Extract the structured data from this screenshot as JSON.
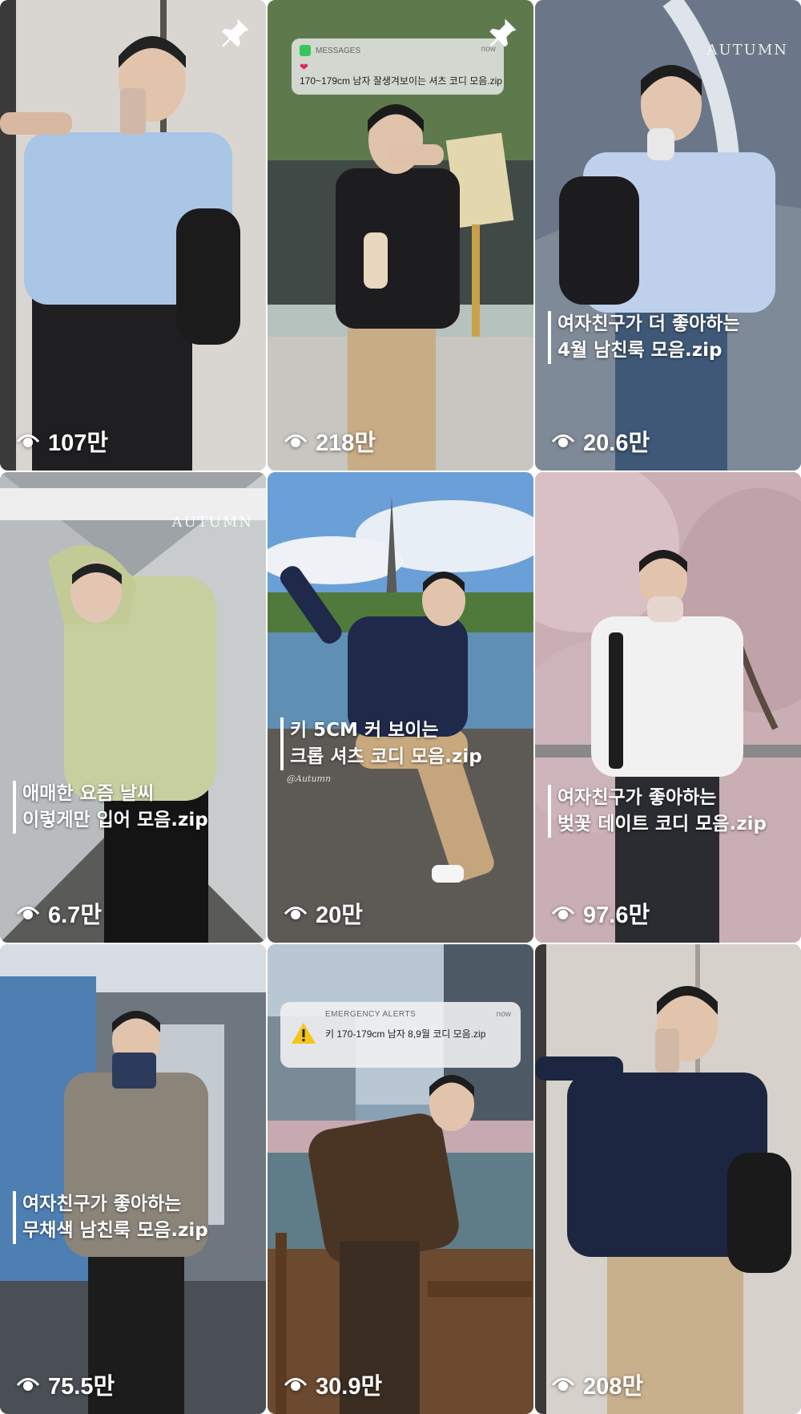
{
  "colors": {
    "overlay_text": "#ffffff",
    "notification_bg": "#ebebeb",
    "messages_app": "#34c759",
    "heart": "#e0245e",
    "alert_triangle": "#f5c518"
  },
  "icons": {
    "views": "eye-icon",
    "pin": "pin-icon",
    "messages": "messages-app-icon",
    "alert": "warning-triangle-icon"
  },
  "tiles": [
    {
      "views": "107만",
      "pinned": true
    },
    {
      "views": "218만",
      "pinned": true,
      "notification": {
        "app": "MESSAGES",
        "time": "now",
        "heart": "❤",
        "text": "170~179cm 남자 잘생겨보이는 셔츠 코디 모음.zip"
      }
    },
    {
      "views": "20.6만",
      "watermark": "AUTUMN",
      "caption": [
        "여자친구가 더 좋아하는",
        "4월 남친룩 모음.zip"
      ]
    },
    {
      "views": "6.7만",
      "watermark": "AUTUMN",
      "caption": [
        "애매한 요즘 날씨",
        "이렇게만 입어 모음.zip"
      ]
    },
    {
      "views": "20만",
      "caption": [
        "키 5CM 커 보이는",
        "크롭 셔츠 코디 모음.zip"
      ],
      "signature": "@Autumn"
    },
    {
      "views": "97.6만",
      "caption": [
        "여자친구가 좋아하는",
        "벚꽃 데이트 코디 모음.zip"
      ]
    },
    {
      "views": "75.5만",
      "caption": [
        "여자친구가 좋아하는",
        "무채색 남친룩 모음.zip"
      ]
    },
    {
      "views": "30.9만",
      "alert": {
        "title": "EMERGENCY ALERTS",
        "time": "now",
        "text": "키 170-179cm 남자 8,9월 코디 모음.zip"
      }
    },
    {
      "views": "208만"
    }
  ]
}
